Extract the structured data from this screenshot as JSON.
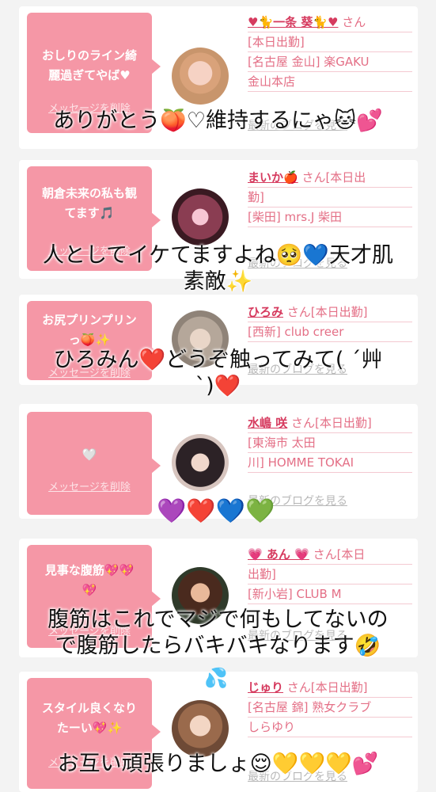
{
  "cards": [
    {
      "message": "おしりのライン綺\n麗過ぎてやば♥",
      "delete_label": "メッセージを削除",
      "name": "♥🐈一条 葵🐈♥",
      "san": " さん",
      "lines": [
        "[本日出勤]",
        "[名古屋 金山] 楽GAKU",
        "金山本店"
      ],
      "blog_label": "最新のブログを見る"
    },
    {
      "message": "朝倉未来の私も観\nてます🎵",
      "delete_label": "メッセージを削除",
      "name": "まいか🍎",
      "san": " さん[本日出",
      "lines": [
        "勤]",
        "[柴田] mrs.J 柴田"
      ],
      "blog_label": "最新のブログを見る"
    },
    {
      "message": "お尻プリンプリン\nっ🍑✨",
      "delete_label": "メッセージを削除",
      "name": "ひろみ",
      "san": " さん[本日出勤]",
      "lines": [
        "[西新] club creer"
      ],
      "blog_label": "最新のブログを見る"
    },
    {
      "message": "🤍",
      "delete_label": "メッセージを削除",
      "name": "水嶋 咲",
      "san": " さん[本日出勤]",
      "lines": [
        "[東海市 太田",
        "川] HOMME TOKAI"
      ],
      "blog_label": "最新のブログを見る"
    },
    {
      "message": "見事な腹筋💖💖\n💖",
      "delete_label": "メッセージを削除",
      "name": "💗 あん 💗",
      "san": " さん[本日",
      "lines": [
        "出勤]",
        "[新小岩] CLUB M"
      ],
      "blog_label": "最新のブログを見る"
    },
    {
      "message": "スタイル良くなり\nたーい💖✨",
      "delete_label": "メッセージを削除",
      "name": "じゅり",
      "san": " さん[本日出勤]",
      "lines": [
        "[名古屋 錦] 熟女クラブ",
        "しらゆり"
      ],
      "blog_label": "最新のブログを見る"
    }
  ],
  "overlays": [
    "ありがとう🍑♡維持するにゃ🐱💕",
    "人としてイケてますよね🥺💙天才肌\n素敵✨",
    "ひろみん❤️どうぞ触ってみて( ´艸\n`)❤️",
    "腹筋はこれでマジで何もしてないの\nで腹筋したらバキバキなります🤣",
    "お互い頑張りましょ😌💛💛💛💕"
  ],
  "hearts_row": "💜❤️💙💚",
  "sweat": "💦"
}
